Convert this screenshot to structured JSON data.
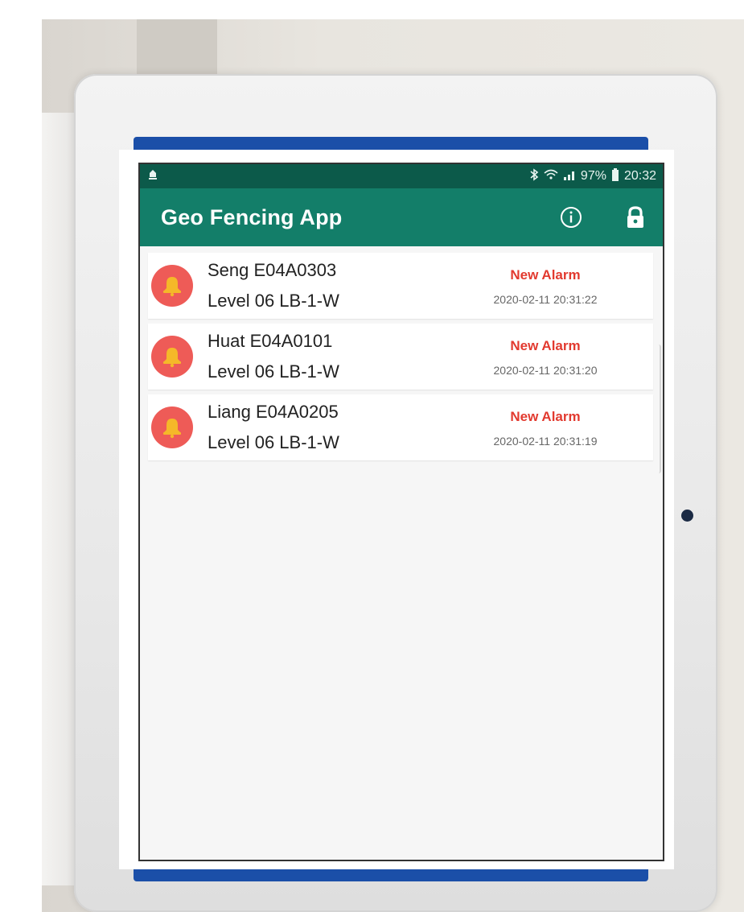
{
  "status_bar": {
    "left_icon": "android-notification-icon",
    "battery": "97%",
    "time": "20:32"
  },
  "app_bar": {
    "title": "Geo Fencing App",
    "actions": [
      "info-icon",
      "lock-icon"
    ]
  },
  "alarms": [
    {
      "name": "Seng E04A0303",
      "location": "Level 06 LB-1-W",
      "status": "New Alarm",
      "timestamp": "2020-02-11 20:31:22"
    },
    {
      "name": "Huat E04A0101",
      "location": "Level 06 LB-1-W",
      "status": "New Alarm",
      "timestamp": "2020-02-11 20:31:20"
    },
    {
      "name": "Liang E04A0205",
      "location": "Level 06 LB-1-W",
      "status": "New Alarm",
      "timestamp": "2020-02-11 20:31:19"
    }
  ],
  "colors": {
    "status_bar": "#0c5a4a",
    "app_bar": "#137e69",
    "alarm_avatar": "#ee5b57",
    "alarm_text": "#e23a2f",
    "bell": "#f5b829"
  }
}
